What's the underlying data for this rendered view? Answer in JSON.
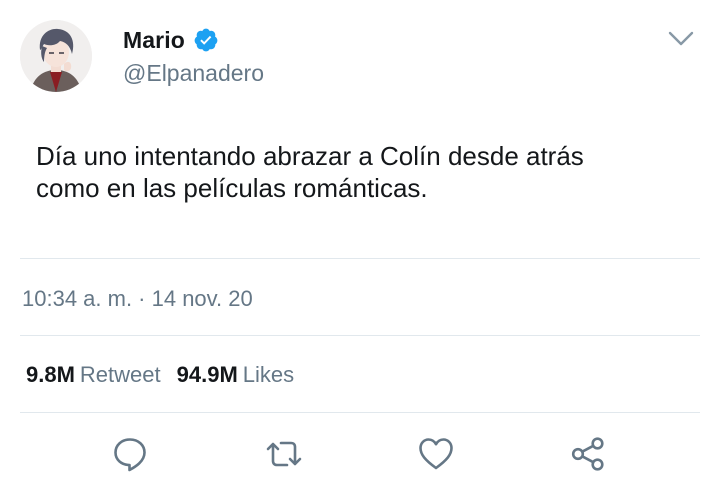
{
  "user": {
    "display_name": "Mario",
    "handle": "@Elpanadero",
    "verified": true,
    "verified_color": "#1da1f2"
  },
  "tweet": {
    "text_line1": "Día uno intentando abrazar a Colín desde atrás",
    "text_line2": "como en las películas románticas."
  },
  "meta": {
    "timestamp": "10:34 a. m. · 14 nov. 20"
  },
  "stats": {
    "retweets_count": "9.8M",
    "retweets_label": "Retweet",
    "likes_count": "94.9M",
    "likes_label": "Likes"
  },
  "actions": [
    "reply-icon",
    "retweet-icon",
    "like-icon",
    "share-icon"
  ],
  "colors": {
    "text": "#14171a",
    "secondary": "#657786",
    "divider": "#e1e8ed"
  }
}
